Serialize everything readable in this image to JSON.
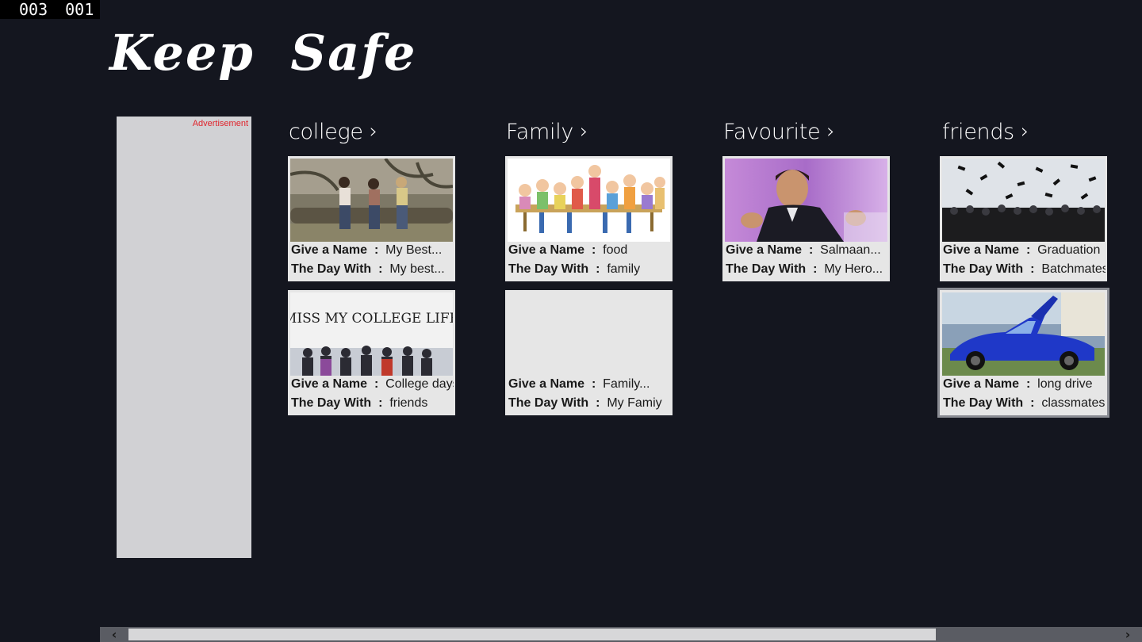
{
  "counter": {
    "left": "003",
    "right": "001"
  },
  "app": {
    "title": "Keep  Safe"
  },
  "ad": {
    "label": "Advertisement"
  },
  "labels": {
    "give_name": "Give a Name",
    "day_with": "The Day With",
    "sep": ":"
  },
  "groups": [
    {
      "title": "college",
      "tiles": [
        {
          "name": "My Best...",
          "with": "My best...",
          "image": "friends-on-log-photo"
        },
        {
          "name": "College days",
          "with": "friends",
          "image": "miss-my-college-life-photo",
          "image_text": "MISS MY COLLEGE LIFE"
        }
      ]
    },
    {
      "title": "Family",
      "tiles": [
        {
          "name": "food",
          "with": "family",
          "image": "family-dinner-cartoon"
        },
        {
          "name": "Family...",
          "with": "My Famiy",
          "image": ""
        }
      ]
    },
    {
      "title": "Favourite",
      "tiles": [
        {
          "name": "Salmaan...",
          "with": "My Hero...",
          "image": "actor-portrait-photo"
        }
      ]
    },
    {
      "title": "friends",
      "tiles": [
        {
          "name": "Graduation",
          "with": "Batchmates",
          "image": "graduation-caps-photo"
        },
        {
          "name": "long drive",
          "with": "classmates",
          "image": "blue-sports-car-photo",
          "selected": true
        }
      ]
    }
  ],
  "colors": {
    "background": "#14161f",
    "tile": "#e6e6e6",
    "ad_panel": "#d1d1d4",
    "ad_label": "#e0232b",
    "scrollbar_track": "#5a5c63",
    "scrollbar_thumb": "#d7d7d9"
  },
  "scrollbar": {
    "left_icon": "chevron-left-icon",
    "right_icon": "chevron-right-icon",
    "position_fraction": 0.0,
    "visible_fraction": 0.82
  }
}
